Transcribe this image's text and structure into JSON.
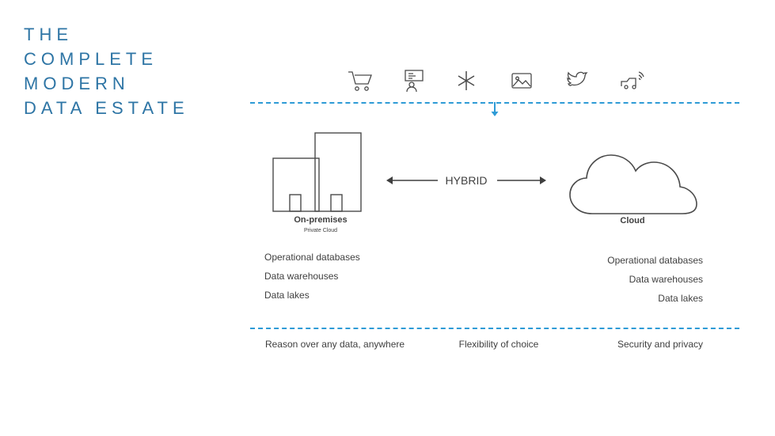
{
  "title": {
    "line1": "THE",
    "line2": "COMPLETE",
    "line3": "MODERN",
    "line4": "DATA ESTATE"
  },
  "colors": {
    "accent": "#2e75a5",
    "dashed": "#2e9bd6",
    "outline": "#4a4a4a",
    "text": "#3f3f3f"
  },
  "top_icons": [
    {
      "name": "shopping-cart-icon",
      "label": "Retail / commerce"
    },
    {
      "name": "presentation-person-icon",
      "label": "Presentation"
    },
    {
      "name": "asterisk-sparkle-icon",
      "label": "Sparkle"
    },
    {
      "name": "image-photo-icon",
      "label": "Media"
    },
    {
      "name": "bird-social-icon",
      "label": "Social"
    },
    {
      "name": "connected-vehicle-icon",
      "label": "Connected vehicle"
    }
  ],
  "hybrid": {
    "label": "HYBRID",
    "arrow_left": "left-arrow-icon",
    "arrow_right": "right-arrow-icon"
  },
  "onprem": {
    "label": "On-premises",
    "sublabel": "Private Cloud",
    "shape": "building-icon",
    "items": [
      "Operational databases",
      "Data warehouses",
      "Data lakes"
    ]
  },
  "cloud": {
    "label": "Cloud",
    "shape": "cloud-icon",
    "items": [
      "Operational databases",
      "Data warehouses",
      "Data lakes"
    ]
  },
  "bottom_captions": [
    "Reason over any data, anywhere",
    "Flexibility of choice",
    "Security and privacy"
  ],
  "down_arrow": "down-arrow-icon"
}
